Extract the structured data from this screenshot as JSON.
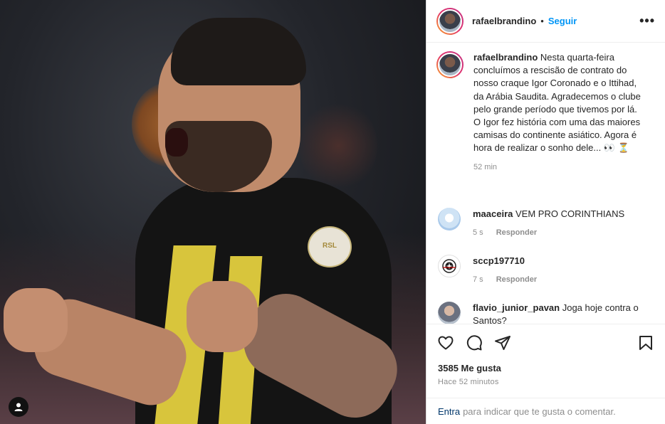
{
  "post": {
    "author": "rafaelbrandino",
    "follow_label": "Seguir",
    "separator": "•",
    "more_label": "•••",
    "caption_text": "Nesta quarta-feira concluímos a rescisão de contrato do nosso craque Igor Coronado e o Ittihad, da Arábia Saudita. Agradecemos o clube pelo grande período que tivemos por lá. O Igor fez história com uma das maiores camisas do continente asiático. Agora é hora de realizar o sonho dele... 👀 ⏳",
    "caption_time": "52 min",
    "likes": "3585 Me gusta",
    "posted_ago": "Hace 52 minutos",
    "badge_text": "RSL"
  },
  "comments": [
    {
      "user": "maaceira",
      "text": "VEM PRO CORINTHIANS",
      "time": "5 s",
      "reply": "Responder",
      "avatar_icon": "user-avatar"
    },
    {
      "user": "sccp197710",
      "text": "",
      "time": "7 s",
      "reply": "Responder",
      "avatar_icon": "corinthians-crest"
    },
    {
      "user": "flavio_junior_pavan",
      "text": "Joga hoje contra o Santos?",
      "time": "",
      "reply": "",
      "avatar_icon": "user-avatar"
    }
  ],
  "actions": {
    "icons": [
      "heart-icon",
      "comment-icon",
      "share-icon",
      "bookmark-icon"
    ]
  },
  "login_prompt": {
    "link": "Entra",
    "text": "para indicar que te gusta o comentar."
  },
  "colors": {
    "follow_blue": "#0095f6",
    "muted": "#8e8e8e",
    "text": "#262626",
    "link": "#00376b",
    "jersey_yellow": "#d8c53c"
  }
}
